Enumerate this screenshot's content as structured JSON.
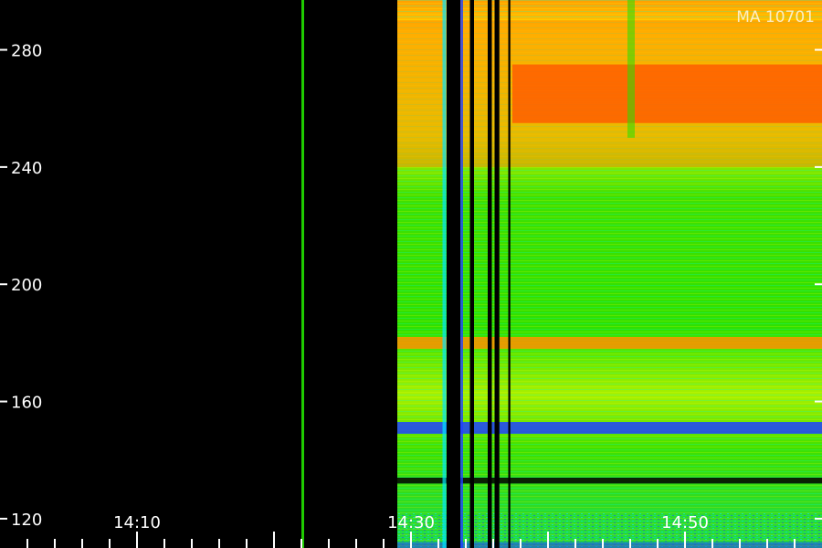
{
  "chart_data": {
    "type": "heatmap",
    "title": "",
    "xlabel": "",
    "ylabel": "",
    "stamp": "MA 10701",
    "x_ticks": [
      "14:10",
      "14:30",
      "14:50"
    ],
    "y_ticks": [
      "280",
      "240",
      "200",
      "160",
      "120"
    ],
    "y_tick_values": [
      280,
      240,
      200,
      160,
      120
    ],
    "x_range": [
      "14:00",
      "15:00"
    ],
    "y_range": [
      110,
      297
    ],
    "signal_start": "14:29",
    "gap_start": "14:22",
    "colormap": {
      "none": "#000000",
      "low": "#2040ff",
      "mid_low": "#00e5ff",
      "mid": "#22e000",
      "mid_high": "#ffff00",
      "high": "#ff9000",
      "peak": "#ff2000"
    },
    "bands": [
      {
        "from": 255,
        "to": 275,
        "level": "peak"
      },
      {
        "from": 240,
        "to": 290,
        "level": "high"
      },
      {
        "from": 178,
        "to": 182,
        "level": "high"
      },
      {
        "from": 149,
        "to": 153,
        "level": "low"
      },
      {
        "from": 132,
        "to": 134,
        "level": "none"
      }
    ]
  }
}
